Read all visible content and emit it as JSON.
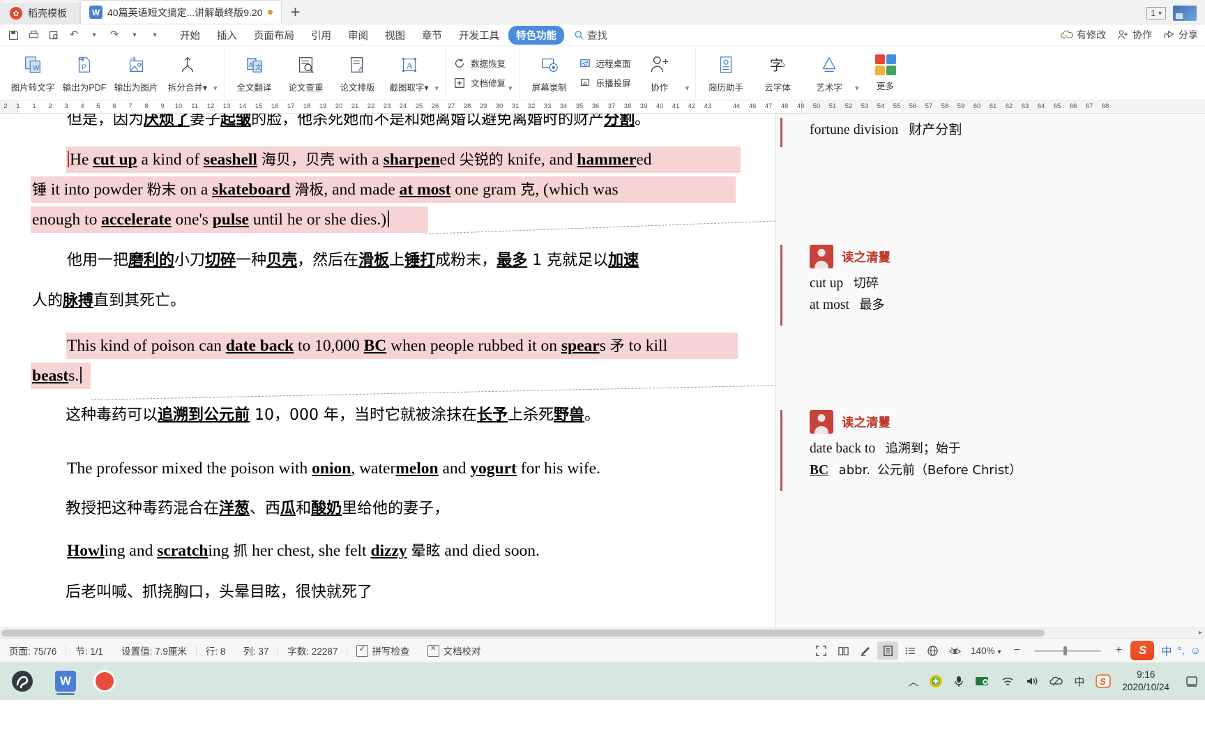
{
  "tabbar": {
    "template_tab": "稻壳模板",
    "doc_tab": "40篇英语短文搞定...讲解最终版9.20",
    "new_tab": "+",
    "window_count": "1"
  },
  "menu": {
    "items": [
      "开始",
      "插入",
      "页面布局",
      "引用",
      "审阅",
      "视图",
      "章节",
      "开发工具",
      "特色功能"
    ],
    "active": "特色功能",
    "find": "查找",
    "right": [
      "有修改",
      "协作",
      "分享"
    ]
  },
  "ribbon": {
    "group1": [
      "图片转文字",
      "输出为PDF",
      "输出为图片",
      "拆分合并"
    ],
    "group2": [
      "全文翻译",
      "论文查重",
      "论文排版",
      "截图取字"
    ],
    "group3": [
      "数据恢复",
      "文档修复"
    ],
    "group4": [
      "屏幕录制",
      "远程桌面",
      "乐播投屏",
      "协作"
    ],
    "group5": [
      "简历助手",
      "云字体",
      "艺术字"
    ],
    "more": "更多"
  },
  "ruler": {
    "ticks": [
      "2",
      "1",
      "1",
      "2",
      "3",
      "4",
      "5",
      "6",
      "7",
      "8",
      "9",
      "10",
      "11",
      "12",
      "13",
      "14",
      "15",
      "16",
      "17",
      "18",
      "19",
      "20",
      "21",
      "22",
      "23",
      "24",
      "25",
      "26",
      "27",
      "28",
      "29",
      "30",
      "31",
      "32",
      "33",
      "34",
      "35",
      "36",
      "37",
      "38",
      "39",
      "40",
      "41",
      "42",
      "43",
      "44",
      "46",
      "47",
      "48",
      "49",
      "50",
      "51",
      "52",
      "53",
      "54",
      "55",
      "56",
      "57",
      "58",
      "59",
      "60",
      "61",
      "62",
      "63",
      "64",
      "65",
      "66",
      "67",
      "68"
    ]
  },
  "document": {
    "lines": [
      {
        "id": "l0",
        "text": "但是，因为厌烦了妻子起皱的脸，他杀死她而不是和她离婚以避免离婚时的财产分割。"
      },
      {
        "id": "l1",
        "text": "He cut up a kind of seashell 海贝，贝壳 with a sharpened 尖锐的 knife, and hammered"
      },
      {
        "id": "l2",
        "text": "锤 it into powder 粉末 on a skateboard 滑板, and made at most one gram 克, (which was"
      },
      {
        "id": "l3",
        "text": "enough to accelerate one's pulse until he or she dies.)"
      },
      {
        "id": "l4",
        "text": "他用一把磨利的小刀切碎一种贝壳，然后在滑板上锤打成粉末，最多 1 克就足以加速"
      },
      {
        "id": "l5",
        "text": "人的脉搏直到其死亡。"
      },
      {
        "id": "l6",
        "text": "This kind of poison can date back to 10,000 BC when people rubbed it on spears 矛 to kill"
      },
      {
        "id": "l7",
        "text": "beasts."
      },
      {
        "id": "l8",
        "text": "这种毒药可以追溯到公元前 10，000 年，当时它就被涂抹在长予上杀死野兽。"
      },
      {
        "id": "l9",
        "text": "The professor mixed the poison with onion, watermelon and yogurt for his wife."
      },
      {
        "id": "l10",
        "text": "教授把这种毒药混合在洋葱、西瓜和酸奶里给他的妻子，"
      },
      {
        "id": "l11",
        "text": "Howling and scratching 抓 her chest, she felt dizzy 晕眩 and died soon."
      },
      {
        "id": "l12",
        "text": "后老叫喊、抓挠胸口，头晕目眩，很快就死了"
      }
    ]
  },
  "comments": [
    {
      "id": "c0",
      "author": "",
      "body_en": "fortune division",
      "body_zh": "财产分割"
    },
    {
      "id": "c1",
      "author": "读之清矍",
      "line1_en": "cut up",
      "line1_zh": "切碎",
      "line2_en": "at most",
      "line2_zh": "最多"
    },
    {
      "id": "c2",
      "author": "读之清矍",
      "line1_en": "date back to",
      "line1_zh": "追溯到；始于",
      "line2_en": "BC",
      "line2_abbr": "abbr.",
      "line2_zh": "公元前（Before Christ）"
    }
  ],
  "status": {
    "page": "页面: 75/76",
    "section": "节: 1/1",
    "setting": "设置值: 7.9厘米",
    "row": "行: 8",
    "col": "列: 37",
    "words": "字数: 22287",
    "spellcheck": "拼写检查",
    "proofread": "文档校对",
    "zoom": "140%",
    "ime_lang": "中"
  },
  "taskbar": {
    "ime": "中",
    "time": "9:16",
    "date": "2020/10/24"
  },
  "colors": {
    "accent": "#4a8bdf",
    "highlight": "#f6d4d3",
    "comment_author": "#c0392b",
    "comment_bar": "#b05a52"
  }
}
